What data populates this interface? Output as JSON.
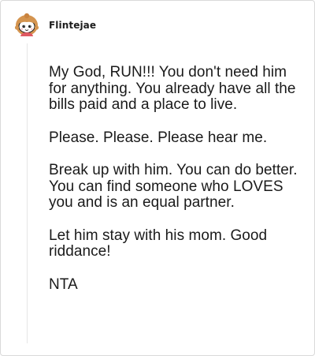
{
  "comment": {
    "username": "Flintejae",
    "avatar_icon": "snoo-avatar-icon",
    "paragraphs": [
      "My God, RUN!!! You don't need him for anything. You already have all the bills paid and a place to live.",
      "Please. Please. Please hear me.",
      "Break up with him. You can do better. You can find someone who LOVES you and is an equal partner.",
      "Let him stay with his mom. Good riddance!",
      "NTA"
    ]
  },
  "colors": {
    "text": "#1a1a1a",
    "border": "#d9d9d9",
    "thread_line": "#e6e6e6",
    "avatar_hair": "#d4944f",
    "avatar_accent": "#e05a63"
  }
}
